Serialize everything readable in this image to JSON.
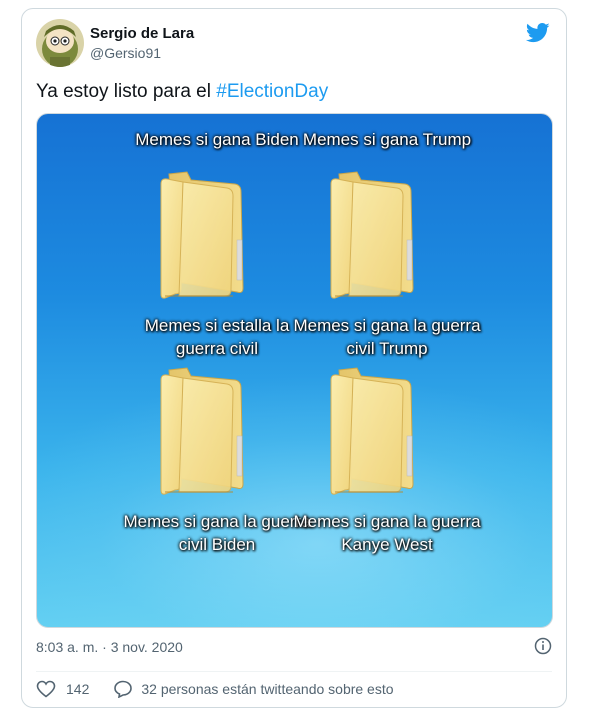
{
  "tweet": {
    "author_name": "Sergio de Lara",
    "author_handle": "@Gersio91",
    "text_prefix": "Ya estoy listo para el ",
    "hashtag": "#ElectionDay",
    "timestamp": "8:03 a. m. · 3 nov. 2020",
    "likes": "142",
    "conversation": "32 personas están twitteando sobre esto"
  },
  "media": {
    "folders": [
      {
        "label": "Memes si gana Biden"
      },
      {
        "label": "Memes si gana Trump"
      },
      {
        "label": "Memes si estalla la guerra civil"
      },
      {
        "label": "Memes si gana la guerra civil Trump"
      },
      {
        "label": "Memes si gana la guerra civil Biden"
      },
      {
        "label": "Memes si gana la guerra Kanye West"
      }
    ]
  },
  "colors": {
    "hashtag": "#1d9bf0",
    "twitter_blue": "#1d9bf0",
    "muted": "#536471"
  },
  "icons": [
    "avatar",
    "twitter-bird-icon",
    "folder-icon",
    "info-icon",
    "heart-icon",
    "reply-bubble-icon"
  ]
}
